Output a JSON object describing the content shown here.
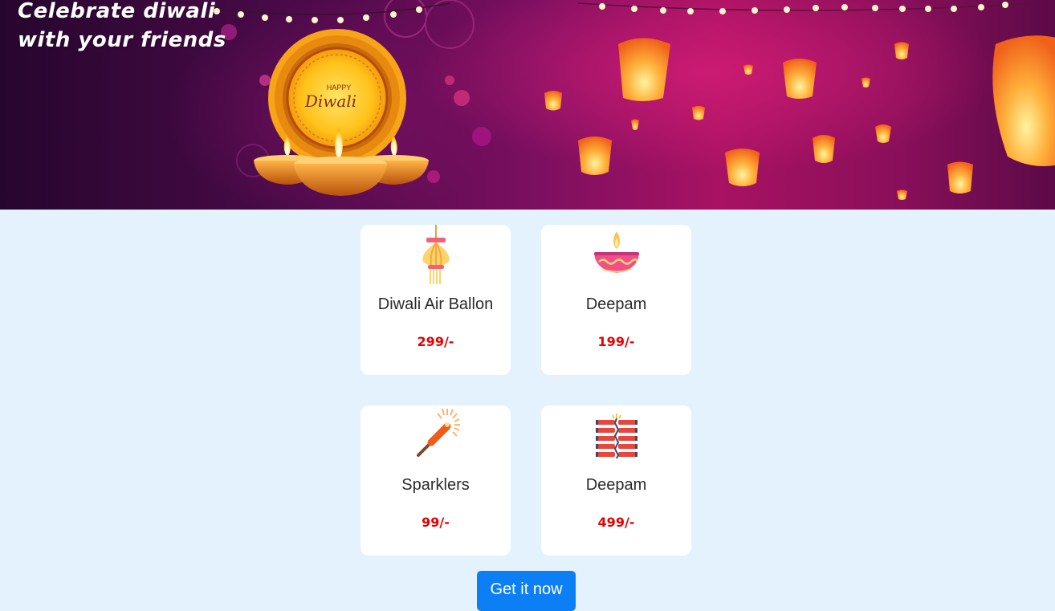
{
  "hero": {
    "title_line1": "Celebrate diwali",
    "title_line2": "with your friends",
    "badge_happy": "HAPPY",
    "badge_diwali": "Diwali"
  },
  "products": [
    {
      "name": "Diwali Air Ballon",
      "price": "299/-",
      "icon": "hanging-lantern-icon"
    },
    {
      "name": "Deepam",
      "price": "199/-",
      "icon": "diya-lamp-icon"
    },
    {
      "name": "Sparklers",
      "price": "99/-",
      "icon": "sparkler-icon"
    },
    {
      "name": "Deepam",
      "price": "499/-",
      "icon": "firecracker-string-icon"
    }
  ],
  "cta": {
    "label": "Get it now"
  },
  "colors": {
    "page_bg": "#e3f2fc",
    "price": "#e60000",
    "button": "#0d7ff5",
    "hero_accent": "#a81262"
  }
}
